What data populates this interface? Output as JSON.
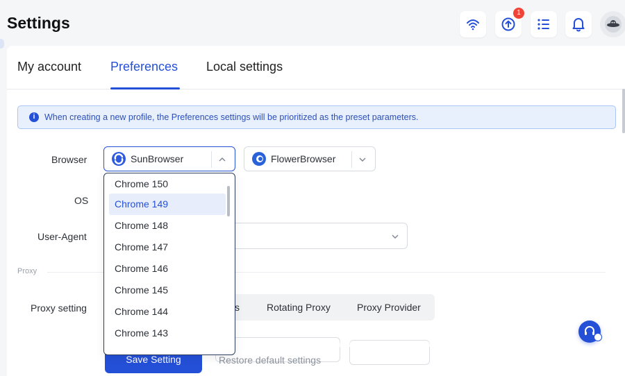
{
  "header": {
    "title": "Settings",
    "icons": [
      "wifi-icon",
      "upload-icon",
      "list-icon",
      "bell-icon",
      "avatar-icon"
    ],
    "upload_badge": "1"
  },
  "tabs": [
    {
      "label": "My account"
    },
    {
      "label": "Preferences",
      "active": true
    },
    {
      "label": "Local settings"
    }
  ],
  "info": {
    "text": "When creating a new profile, the Preferences settings will be prioritized as the preset parameters."
  },
  "form": {
    "browser_label": "Browser",
    "browser1": "SunBrowser",
    "browser2": "FlowerBrowser",
    "os_label": "OS",
    "ua_label": "User-Agent"
  },
  "dropdown": {
    "items": [
      "Chrome 150",
      "Chrome 149",
      "Chrome 148",
      "Chrome 147",
      "Chrome 146",
      "Chrome 145",
      "Chrome 144",
      "Chrome 143"
    ],
    "selected": "Chrome 149"
  },
  "proxy": {
    "section_label": "Proxy",
    "setting_label": "Proxy setting",
    "options": [
      "s",
      "Rotating Proxy",
      "Proxy Provider"
    ]
  },
  "actions": {
    "save": "Save Setting",
    "restore": "Restore default settings"
  },
  "colors": {
    "accent": "#2450d8",
    "info_bg": "#e8f0fd",
    "badge": "#f04438"
  }
}
